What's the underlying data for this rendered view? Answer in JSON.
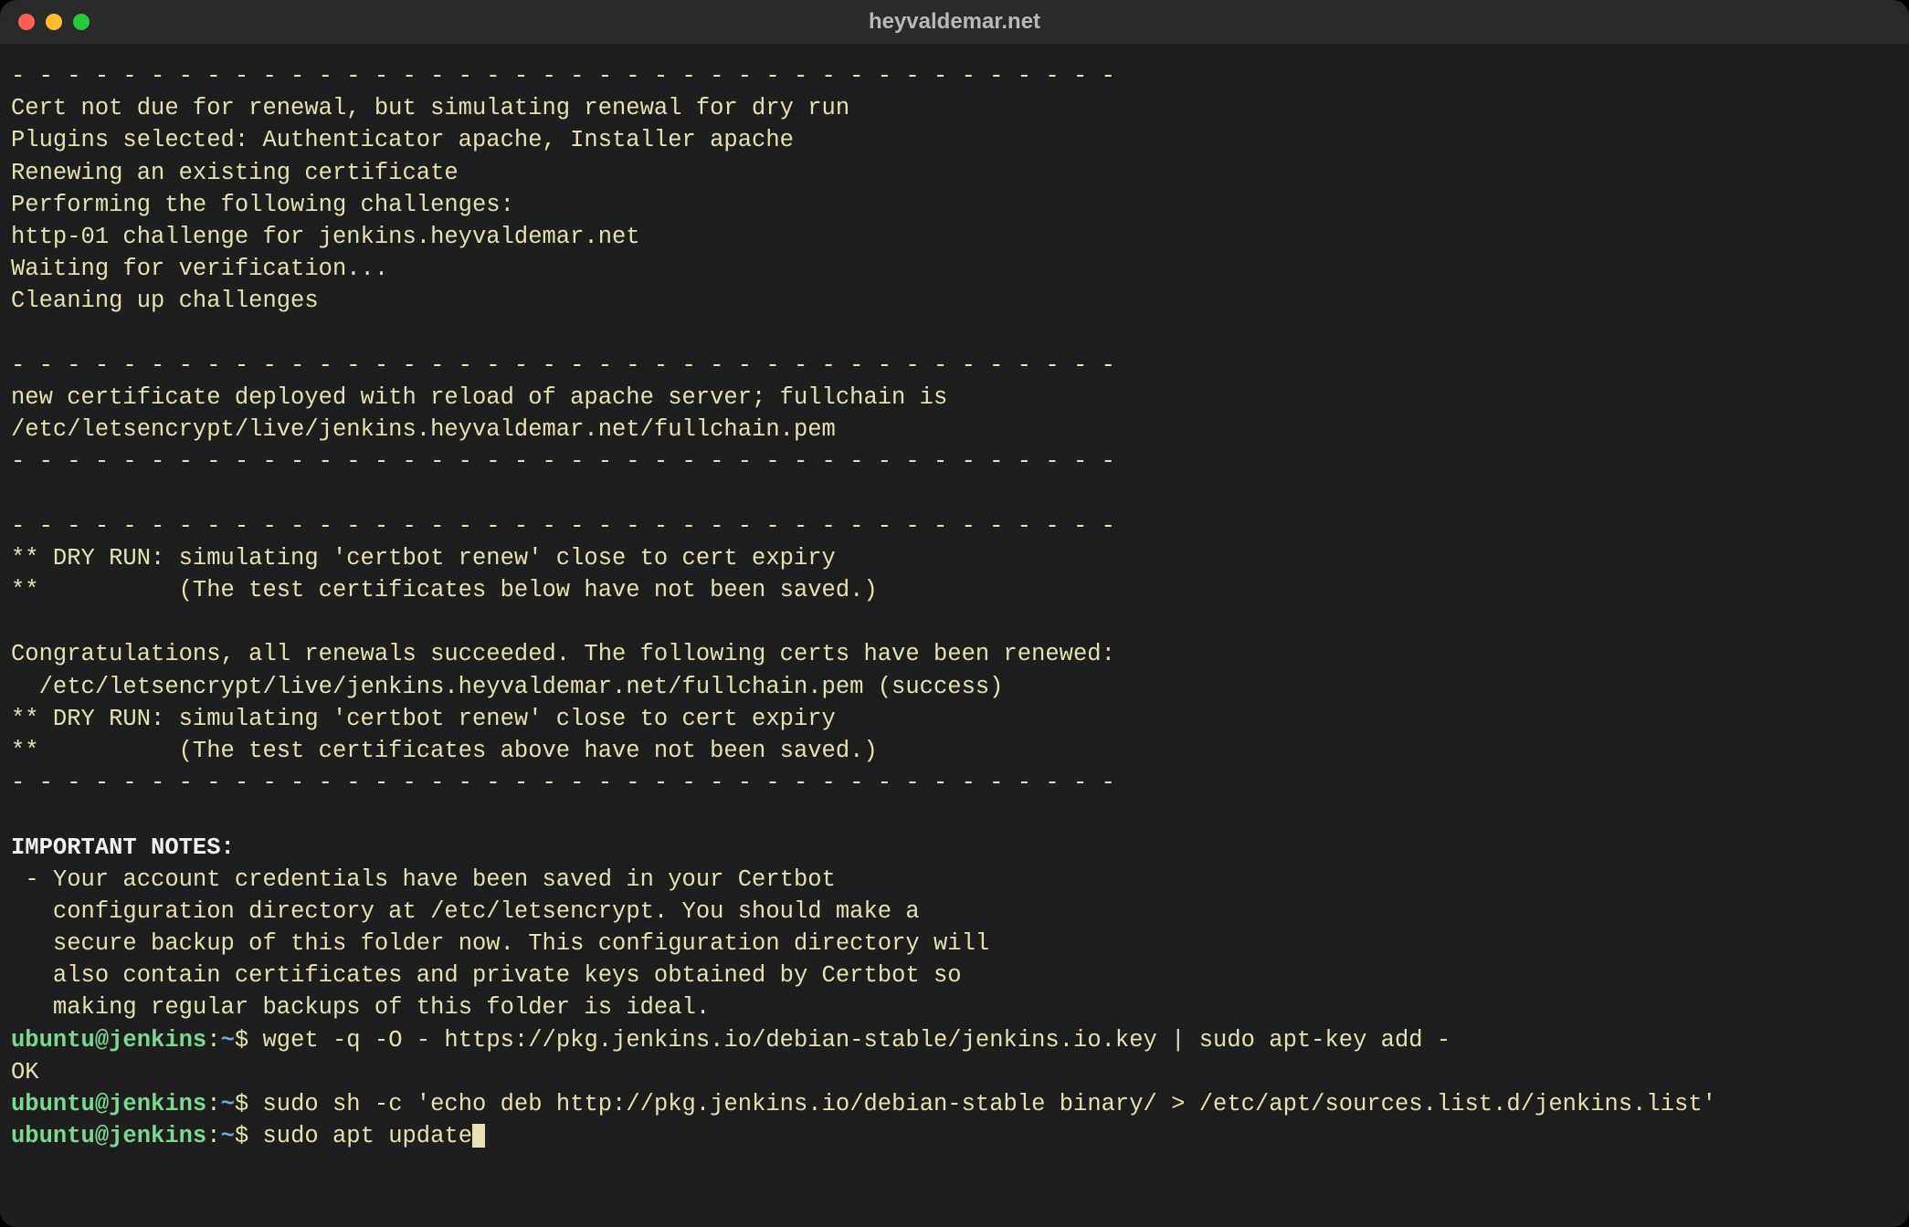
{
  "window": {
    "title": "heyvaldemar.net"
  },
  "colors": {
    "bg": "#1e1e1e",
    "titlebar": "#2a2a2a",
    "text": "#e8e0b0",
    "bold": "#f0f0f0",
    "user": "#7bd88f",
    "path": "#6fa8dc",
    "red": "#ff5f56",
    "yellow": "#ffbd2e",
    "green": "#27c93f"
  },
  "terminal": {
    "dash_line": "- - - - - - - - - - - - - - - - - - - - - - - - - - - - - - - - - - - - - - - -",
    "output": {
      "l1": "Cert not due for renewal, but simulating renewal for dry run",
      "l2": "Plugins selected: Authenticator apache, Installer apache",
      "l3": "Renewing an existing certificate",
      "l4": "Performing the following challenges:",
      "l5": "http-01 challenge for jenkins.heyvaldemar.net",
      "l6": "Waiting for verification...",
      "l7": "Cleaning up challenges",
      "l8": "new certificate deployed with reload of apache server; fullchain is",
      "l9": "/etc/letsencrypt/live/jenkins.heyvaldemar.net/fullchain.pem",
      "l10": "** DRY RUN: simulating 'certbot renew' close to cert expiry",
      "l11": "**          (The test certificates below have not been saved.)",
      "l12": "Congratulations, all renewals succeeded. The following certs have been renewed:",
      "l13": "  /etc/letsencrypt/live/jenkins.heyvaldemar.net/fullchain.pem (success)",
      "l14": "** DRY RUN: simulating 'certbot renew' close to cert expiry",
      "l15": "**          (The test certificates above have not been saved.)",
      "notes_heading": "IMPORTANT NOTES:",
      "note1": " - Your account credentials have been saved in your Certbot",
      "note2": "   configuration directory at /etc/letsencrypt. You should make a",
      "note3": "   secure backup of this folder now. This configuration directory will",
      "note4": "   also contain certificates and private keys obtained by Certbot so",
      "note5": "   making regular backups of this folder is ideal.",
      "ok": "OK"
    },
    "prompts": [
      {
        "user": "ubuntu@jenkins",
        "colon": ":",
        "path": "~",
        "dollar": "$ ",
        "cmd": "wget -q -O - https://pkg.jenkins.io/debian-stable/jenkins.io.key | sudo apt-key add -"
      },
      {
        "user": "ubuntu@jenkins",
        "colon": ":",
        "path": "~",
        "dollar": "$ ",
        "cmd": "sudo sh -c 'echo deb http://pkg.jenkins.io/debian-stable binary/ > /etc/apt/sources.list.d/jenkins.list'"
      },
      {
        "user": "ubuntu@jenkins",
        "colon": ":",
        "path": "~",
        "dollar": "$ ",
        "cmd": "sudo apt update"
      }
    ]
  }
}
